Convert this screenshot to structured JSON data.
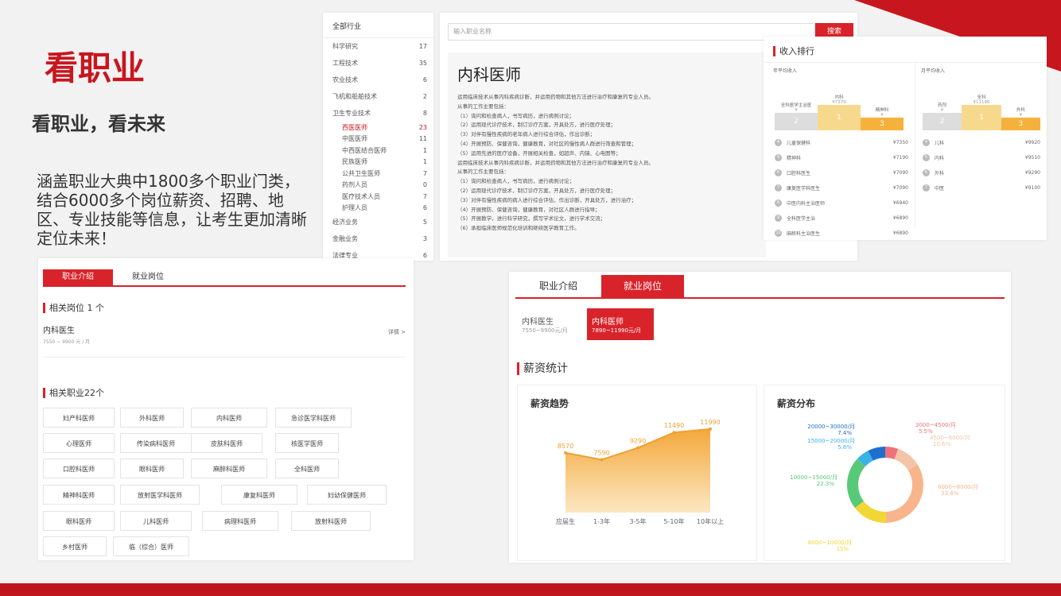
{
  "intro": {
    "title": "看职业",
    "subtitle": "看职业，看未来",
    "desc": "涵盖职业大典中1800多个职业门类，结合6000多个岗位薪资、招聘、地区、专业技能等信息，让考生更加清晰定位未来！"
  },
  "categories": {
    "header": "全部行业",
    "items": [
      {
        "label": "科学研究",
        "count": "17"
      },
      {
        "label": "工程技术",
        "count": "35"
      },
      {
        "label": "农业技术",
        "count": "6"
      },
      {
        "label": "飞机和船舶技术",
        "count": "2"
      },
      {
        "label": "卫生专业技术",
        "count": "8"
      }
    ],
    "sub": [
      {
        "label": "西医医师",
        "count": "23"
      },
      {
        "label": "中医医师",
        "count": "11"
      },
      {
        "label": "中西医结合医师",
        "count": "1"
      },
      {
        "label": "民族医师",
        "count": "1"
      },
      {
        "label": "公共卫生医师",
        "count": "7"
      },
      {
        "label": "药剂人员",
        "count": "0"
      },
      {
        "label": "医疗技术人员",
        "count": "7"
      },
      {
        "label": "护理人员",
        "count": "6"
      }
    ],
    "tail": [
      {
        "label": "经济业务",
        "count": "5"
      },
      {
        "label": "金融业务",
        "count": "3"
      },
      {
        "label": "法律专业",
        "count": "6"
      }
    ]
  },
  "search": {
    "placeholder": "输入职业名称",
    "button": "搜索"
  },
  "career": {
    "name": "内科医师",
    "lines": [
      "运用临床技术从事内科疾病诊断，并运用药物和其他方法进行治疗和康复的专业人员。",
      "从事的工作主要包括：",
      "（1）询问和检查病人，书写病历，进行病例讨论；",
      "（2）运用现代诊疗技术，制订诊疗方案，开具处方，进行医疗处理；",
      "（3）对伴有慢性疾病的老年病人进行综合评估，作出诊断；",
      "（4）开展预防、保健咨询，健康教育，对社区的慢性病人群进行筛查和管理；",
      "（5）运用先进的医疗设备，开展相关检查，如超声、内镜、心电图等；",
      "运用临床技术从事内科疾病诊断，并运用药物和其他方法进行治疗和康复的专业人员。",
      "从事的工作主要包括：",
      "（1）询问和检查病人，书写病历，进行病例讨论；",
      "（2）运用现代诊疗技术，制订诊疗方案，开具处方，进行医疗处理；",
      "（3）对伴有慢性疾病的病人进行综合评估，作出诊断，开具处方，进行治疗；",
      "（4）开展预防、保健咨询，健康教育，对社区人群进行指导；",
      "（5）开展教学，进行科学研究，撰写学术论文，进行学术交流；",
      "（6）承担临床医师规范化培训和继续医学教育工作。"
    ]
  },
  "rank": {
    "title": "收入排行",
    "left_title": "年平均收入",
    "right_title": "月平均收入",
    "left_podium": [
      {
        "label": "全科医学主治医",
        "value": "¥",
        "place": "2"
      },
      {
        "label": "内科",
        "value": "¥7370",
        "place": "1"
      },
      {
        "label": "精神科",
        "value": "¥",
        "place": "3"
      }
    ],
    "right_podium": [
      {
        "label": "药剂",
        "value": "¥",
        "place": "2"
      },
      {
        "label": "全科",
        "value": "¥11190",
        "place": "1"
      },
      {
        "label": "外科",
        "value": "¥",
        "place": "3"
      }
    ],
    "left_rows": [
      {
        "n": "4",
        "name": "儿童保健科",
        "val": "¥7350"
      },
      {
        "n": "5",
        "name": "精神科",
        "val": "¥7190"
      },
      {
        "n": "6",
        "name": "口腔科医生",
        "val": "¥7090"
      },
      {
        "n": "7",
        "name": "康复医学科医生",
        "val": "¥7090"
      },
      {
        "n": "8",
        "name": "中医内科主治医师",
        "val": "¥6940"
      },
      {
        "n": "9",
        "name": "全科医学主治",
        "val": "¥6890"
      },
      {
        "n": "10",
        "name": "麻醉科主治医生",
        "val": "¥6890"
      }
    ],
    "right_rows": [
      {
        "n": "4",
        "name": "儿科",
        "val": "¥9920"
      },
      {
        "n": "5",
        "name": "内科",
        "val": "¥9510"
      },
      {
        "n": "6",
        "name": "外科",
        "val": "¥9290"
      },
      {
        "n": "7",
        "name": "中医",
        "val": "¥9100"
      }
    ]
  },
  "jobs": {
    "tabs": [
      "职业介绍",
      "就业岗位"
    ],
    "related_title": "相关岗位 1 个",
    "post_name": "内科医生",
    "post_salary": "7550 ~ 9900 元 / 月",
    "more": "详情 >",
    "careers_title": "相关职业22个",
    "tags": [
      "妇产科医师",
      "外科医师",
      "内科医师",
      "急诊医学科医师",
      "心理医师",
      "传染病科医师",
      "皮肤科医师",
      "核医学医师",
      "口腔科医师",
      "眼科医师",
      "麻醉科医师",
      "全科医师",
      "精神科医师",
      "放射医学科医师",
      "康复科医师",
      "妇幼保健医师",
      "眼科医师",
      "儿科医师",
      "病理科医师",
      "放射科医师",
      "乡村医师",
      "临（综合）医师"
    ]
  },
  "salary": {
    "tabs": [
      "职业介绍",
      "就业岗位"
    ],
    "posts": [
      {
        "name": "内科医生",
        "range": "7550~9900元/月"
      },
      {
        "name": "内科医师",
        "range": "7890~11990元/月"
      }
    ],
    "stats_title": "薪资统计",
    "trend_title": "薪资趋势",
    "dist_title": "薪资分布"
  },
  "chart_data": [
    {
      "type": "area",
      "title": "薪资趋势",
      "categories": [
        "应届生",
        "1-3年",
        "3-5年",
        "5-10年",
        "10年以上"
      ],
      "series": [
        {
          "values": [
            8570,
            7590,
            9290,
            11490,
            11990
          ]
        }
      ],
      "point_labels": [
        "8570",
        "7590",
        "9290",
        "11490",
        "11990"
      ],
      "ylim": [
        0,
        13000
      ]
    },
    {
      "type": "pie",
      "title": "薪资分布",
      "slices": [
        {
          "label": "3000~4500/月",
          "value": 5.5,
          "color": "#f0707a"
        },
        {
          "label": "4500~6000/月",
          "value": 10.6,
          "color": "#f4c4a8"
        },
        {
          "label": "6000~8000/月",
          "value": 33.4,
          "color": "#f8b48c"
        },
        {
          "label": "8000~10000/月",
          "value": 15,
          "color": "#f2d635"
        },
        {
          "label": "10000~15000/月",
          "value": 22.3,
          "color": "#58c979"
        },
        {
          "label": "15000~20000/月",
          "value": 5.6,
          "color": "#39b3e6"
        },
        {
          "label": "20000~30000/月",
          "value": 7.4,
          "color": "#1f6fd1"
        }
      ],
      "label_texts": [
        "3000~4500/月",
        "5.5%",
        "4500~6000/月",
        "10.6%",
        "6000~8000/月",
        "33.4%",
        "8000~10000/月",
        "15%",
        "10000~15000/月",
        "22.3%",
        "15000~20000/月",
        "5.6%",
        "20000~30000/月",
        "7.4%"
      ]
    }
  ]
}
